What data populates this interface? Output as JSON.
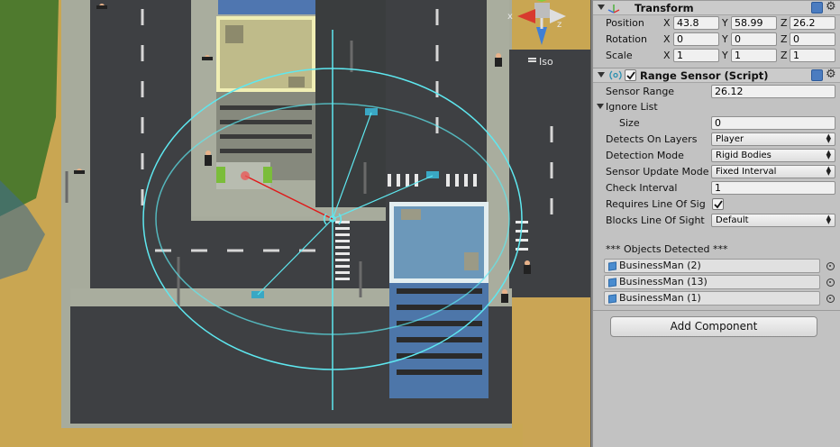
{
  "scene": {
    "iso_label": "Iso",
    "gizmo_axes": {
      "x": "x",
      "y": "y",
      "z": "z"
    }
  },
  "transform": {
    "title": "Transform",
    "position": {
      "label": "Position",
      "x": "43.8",
      "y": "58.99",
      "z": "26.2"
    },
    "rotation": {
      "label": "Rotation",
      "x": "0",
      "y": "0",
      "z": "0"
    },
    "scale": {
      "label": "Scale",
      "x": "1",
      "y": "1",
      "z": "1"
    },
    "axis_labels": {
      "x": "X",
      "y": "Y",
      "z": "Z"
    }
  },
  "range_sensor": {
    "title": "Range Sensor (Script)",
    "enabled": true,
    "sensor_range": {
      "label": "Sensor Range",
      "value": "26.12"
    },
    "ignore_list": {
      "label": "Ignore List",
      "size_label": "Size",
      "size_value": "0"
    },
    "detects_on_layers": {
      "label": "Detects On Layers",
      "value": "Player"
    },
    "detection_mode": {
      "label": "Detection Mode",
      "value": "Rigid Bodies"
    },
    "sensor_update_mode": {
      "label": "Sensor Update Mode",
      "value": "Fixed Interval"
    },
    "check_interval": {
      "label": "Check Interval",
      "value": "1"
    },
    "requires_line_of_sight": {
      "label": "Requires Line Of Sig",
      "checked": true
    },
    "blocks_line_of_sight": {
      "label": "Blocks Line Of Sight",
      "value": "Default"
    },
    "objects_detected_header": "*** Objects Detected ***",
    "objects_detected": [
      {
        "name": "BusinessMan (2)"
      },
      {
        "name": "BusinessMan (13)"
      },
      {
        "name": "BusinessMan (1)"
      }
    ]
  },
  "add_component_label": "Add Component",
  "colors": {
    "sand": "#c9a652",
    "road": "#3d3f42",
    "sidewalk": "#a9ad9e",
    "sensor_gizmo": "#5ee8f0",
    "detection_ray": "#e01818",
    "grass": "#4f7a2e"
  }
}
